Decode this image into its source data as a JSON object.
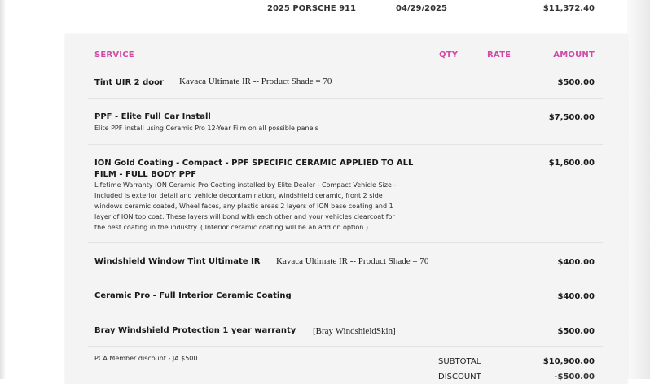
{
  "top": {
    "vehicle": "2025 PORSCHE 911",
    "date": "04/29/2025",
    "total": "$11,372.40"
  },
  "columns": {
    "service": "SERVICE",
    "qty": "QTY",
    "rate": "RATE",
    "amount": "AMOUNT"
  },
  "items": [
    {
      "title": "Tint UIR 2 door",
      "note": "Kavaca Ultimate IR -- Product Shade = 70",
      "amount": "$500.00"
    },
    {
      "title": "PPF - Elite Full Car Install",
      "description": "Elite PPF install using Ceramic Pro 12-Year Film on all possible panels",
      "amount": "$7,500.00"
    },
    {
      "title_line1": "ION Gold Coating - Compact - PPF SPECIFIC CERAMIC APPLIED TO ALL",
      "title_line2": "FILM - FULL BODY PPF",
      "description_lines": [
        "Lifetime Warranty ION Ceramic Pro Coating installed by Elite Dealer - Compact Vehicle Size -",
        "Included is exterior detail and vehicle decontamination, windshield ceramic, front 2 side",
        "windows ceramic coated, Wheel faces, any plastic areas 2 layers of ION base coating and 1",
        "layer of ION top coat. These layers will bond with each other and your vehicles clearcoat for",
        "the best coating in the industry. ( Interior ceramic coating will be an add on option )"
      ],
      "amount": "$1,600.00"
    },
    {
      "title": "Windshield Window Tint Ultimate IR",
      "note": "Kavaca Ultimate IR -- Product Shade = 70",
      "amount": "$400.00"
    },
    {
      "title": "Ceramic Pro - Full Interior Ceramic Coating",
      "amount": "$400.00"
    },
    {
      "title": "Bray Windshield Protection 1 year warranty",
      "note": "[Bray WindshieldSkin]",
      "amount": "$500.00"
    }
  ],
  "footer": {
    "member_note": "PCA Member discount - JA $500",
    "subtotal_label": "SUBTOTAL",
    "subtotal": "$10,900.00",
    "discount_label": "DISCOUNT",
    "discount": "-$500.00"
  }
}
